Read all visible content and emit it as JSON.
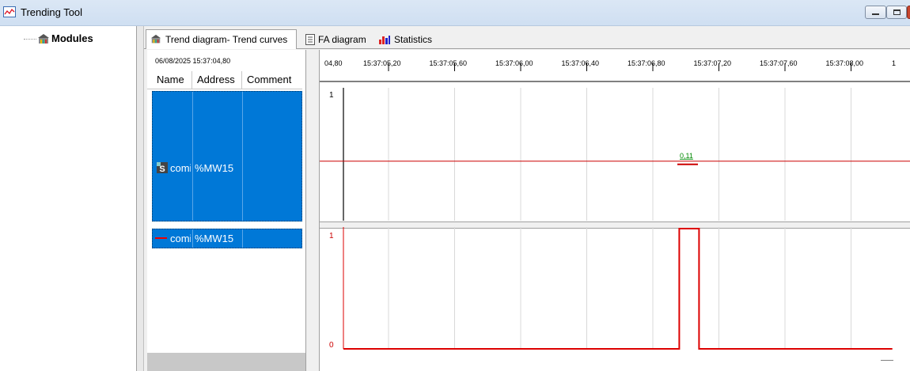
{
  "window": {
    "title": "Trending Tool"
  },
  "tree": {
    "root_label": "Modules"
  },
  "tabs": [
    {
      "label": "Trend diagram- Trend curves"
    },
    {
      "label": "FA diagram"
    },
    {
      "label": "Statistics"
    }
  ],
  "list": {
    "timestamp": "06/08/2025 15:37:04,80",
    "columns": [
      "Name",
      "Address",
      "Comment"
    ],
    "rows": [
      {
        "name": "comi",
        "address": "%MW15",
        "comment": ""
      },
      {
        "name": "comi",
        "address": "%MW15",
        "comment": ""
      }
    ]
  },
  "time_axis": {
    "ticks": [
      "04,80",
      "15:37:05,20",
      "15:37:05,60",
      "15:37:06,00",
      "15:37:06,40",
      "15:37:06,80",
      "15:37:07,20",
      "15:37:07,60",
      "15:37:08,00",
      "1"
    ]
  },
  "chart_data": [
    {
      "type": "line",
      "panel": "top",
      "y_tick_label": "1",
      "series": [
        {
          "values": [
            0.11,
            0.11,
            0.11,
            0.11,
            0.11,
            0.11,
            0.11,
            0.11,
            0.11,
            0.11
          ]
        }
      ],
      "x": [
        "04,80",
        "15:37:05,20",
        "15:37:05,60",
        "15:37:06,00",
        "15:37:06,40",
        "15:37:06,80",
        "15:37:07,20",
        "15:37:07,60",
        "15:37:08,00",
        "1"
      ],
      "annotation": "0,11",
      "color": "#cc0000",
      "grid": true
    },
    {
      "type": "line",
      "panel": "bottom",
      "y_tick_labels": [
        "1",
        "0"
      ],
      "step": true,
      "series": [
        {
          "points": [
            {
              "x": "15:37:04,80",
              "y": 0
            },
            {
              "x": "15:37:06,96",
              "y": 0
            },
            {
              "x": "15:37:06,96",
              "y": 1
            },
            {
              "x": "15:37:07,08",
              "y": 1
            },
            {
              "x": "15:37:07,08",
              "y": 0
            },
            {
              "x": "15:37:08,25",
              "y": 0
            }
          ]
        }
      ],
      "color": "#dd0000",
      "grid": true
    }
  ]
}
